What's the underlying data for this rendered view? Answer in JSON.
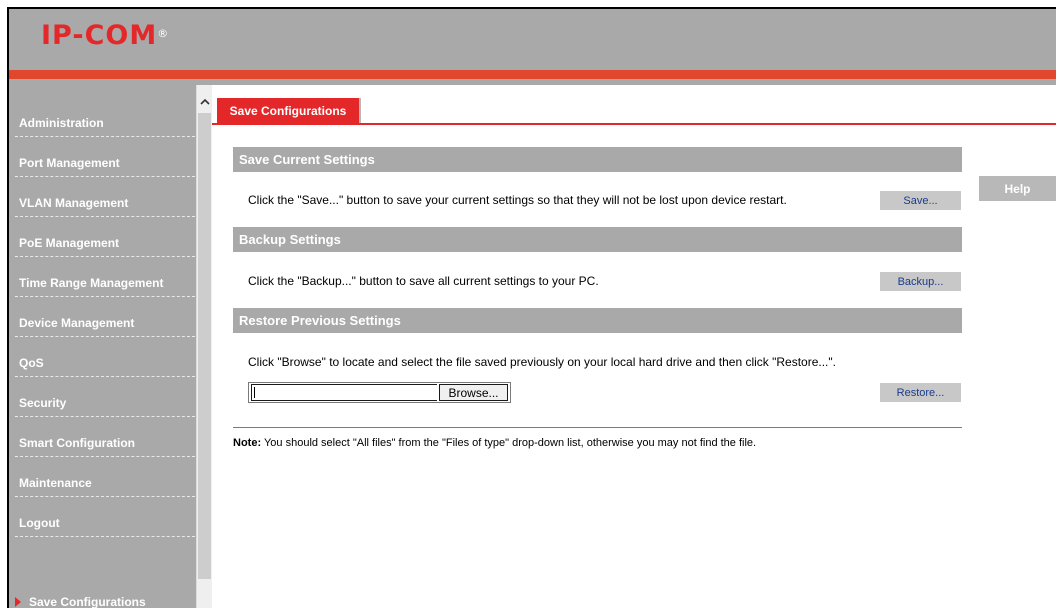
{
  "header": {
    "logo_text": "IP-COM",
    "logo_mark": "®"
  },
  "sidebar": {
    "items": [
      {
        "label": "Administration"
      },
      {
        "label": "Port Management"
      },
      {
        "label": "VLAN Management"
      },
      {
        "label": "PoE Management"
      },
      {
        "label": "Time Range Management"
      },
      {
        "label": "Device Management"
      },
      {
        "label": "QoS"
      },
      {
        "label": "Security"
      },
      {
        "label": "Smart Configuration"
      },
      {
        "label": "Maintenance"
      },
      {
        "label": "Logout"
      }
    ],
    "active_label": "Save Configurations"
  },
  "tab": {
    "label": "Save Configurations"
  },
  "sections": {
    "save": {
      "title": "Save Current Settings",
      "text": "Click the \"Save...\" button to save your current settings so that they will not be lost upon device restart.",
      "button": "Save..."
    },
    "backup": {
      "title": "Backup Settings",
      "text": "Click the \"Backup...\" button to save all current settings to your PC.",
      "button": "Backup..."
    },
    "restore": {
      "title": "Restore Previous Settings",
      "text": "Click \"Browse\" to locate and select the file saved previously on your local hard drive and then click \"Restore...\".",
      "browse_label": "Browse...",
      "file_value": "",
      "button": "Restore..."
    }
  },
  "note": {
    "prefix": "Note:",
    "text": " You should select \"All files\" from the \"Files of type\" drop-down list, otherwise you may not find the file."
  },
  "help": {
    "label": "Help"
  },
  "colors": {
    "accent": "#e4282a",
    "stripe": "#e1472d",
    "chrome": "#a9a9a9"
  }
}
